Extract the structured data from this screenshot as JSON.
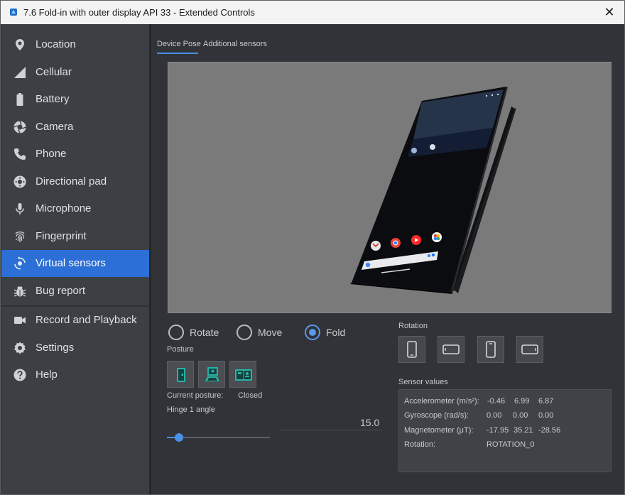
{
  "window": {
    "title": "7.6  Fold-in with outer display API 33 - Extended Controls",
    "close_glyph": "✕"
  },
  "sidebar": {
    "items": [
      {
        "label": "Location",
        "icon": "location-pin-icon"
      },
      {
        "label": "Cellular",
        "icon": "signal-icon"
      },
      {
        "label": "Battery",
        "icon": "battery-icon"
      },
      {
        "label": "Camera",
        "icon": "camera-shutter-icon"
      },
      {
        "label": "Phone",
        "icon": "phone-icon"
      },
      {
        "label": "Directional pad",
        "icon": "dpad-icon"
      },
      {
        "label": "Microphone",
        "icon": "microphone-icon"
      },
      {
        "label": "Fingerprint",
        "icon": "fingerprint-icon"
      },
      {
        "label": "Virtual sensors",
        "icon": "rotation-icon",
        "active": true
      },
      {
        "label": "Bug report",
        "icon": "bug-icon"
      },
      {
        "label": "Record and Playback",
        "icon": "video-camera-icon"
      },
      {
        "label": "Settings",
        "icon": "gear-icon"
      },
      {
        "label": "Help",
        "icon": "help-icon"
      }
    ]
  },
  "tabs": [
    {
      "label": "Device Pose",
      "selected": true
    },
    {
      "label": "Additional sensors",
      "selected": false
    }
  ],
  "mode": {
    "options": [
      "Rotate",
      "Move",
      "Fold"
    ],
    "selected": "Fold"
  },
  "posture": {
    "label": "Posture",
    "current_label": "Current posture:",
    "current_value": "Closed",
    "buttons": [
      "closed-posture-icon",
      "tabletop-posture-icon",
      "open-posture-icon"
    ]
  },
  "hinge": {
    "label": "Hinge 1 angle",
    "value": "15.0",
    "slider_fraction": 0.083
  },
  "rotation": {
    "label": "Rotation",
    "buttons": [
      "portrait-icon",
      "landscape-icon",
      "portrait-reverse-icon",
      "landscape-reverse-icon"
    ]
  },
  "sensors": {
    "label": "Sensor values",
    "rows": [
      {
        "name": "Accelerometer (m/s²):",
        "values": [
          "-0.46",
          "6.99",
          "6.87"
        ]
      },
      {
        "name": "Gyroscope (rad/s):",
        "values": [
          "0.00",
          "0.00",
          "0.00"
        ]
      },
      {
        "name": "Magnetometer (μT):",
        "values": [
          "-17.95",
          "35.21",
          "-28.56"
        ]
      },
      {
        "name": "Rotation:",
        "values": [
          "ROTATION_0"
        ]
      }
    ]
  },
  "colors": {
    "accent": "#2c6fd6",
    "posture_icon": "#23b5a6"
  }
}
